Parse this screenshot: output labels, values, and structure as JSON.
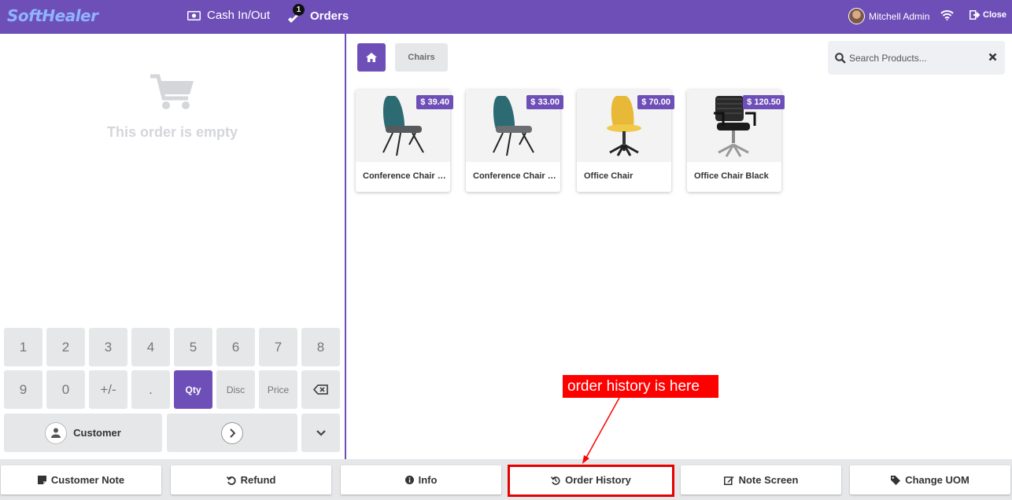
{
  "topbar": {
    "logo": "SoftHealer",
    "cash_label": "Cash In/Out",
    "orders_label": "Orders",
    "orders_badge": "1",
    "user_name": "Mitchell Admin",
    "close_label": "Close"
  },
  "order": {
    "empty_text": "This order is empty"
  },
  "numpad": {
    "row1": [
      "1",
      "2",
      "3",
      "4",
      "5",
      "6",
      "7",
      "8"
    ],
    "row2": [
      "9",
      "0",
      "+/-",
      ".",
      "Qty",
      "Disc",
      "Price"
    ],
    "customer_label": "Customer"
  },
  "products_header": {
    "category": "Chairs",
    "search_placeholder": "Search Products..."
  },
  "products": [
    {
      "name": "Conference Chair (Aluminium)",
      "price": "$ 39.40"
    },
    {
      "name": "Conference Chair (Steel)",
      "price": "$ 33.00"
    },
    {
      "name": "Office Chair",
      "price": "$ 70.00"
    },
    {
      "name": "Office Chair Black",
      "price": "$ 120.50"
    }
  ],
  "bottom_buttons": {
    "customer_note": "Customer Note",
    "refund": "Refund",
    "info": "Info",
    "order_history": "Order History",
    "note_screen": "Note Screen",
    "change_uom": "Change UOM"
  },
  "annotation": {
    "text": "order history is here",
    "color": "#ff0000"
  },
  "colors": {
    "accent": "#6e4fb8"
  }
}
